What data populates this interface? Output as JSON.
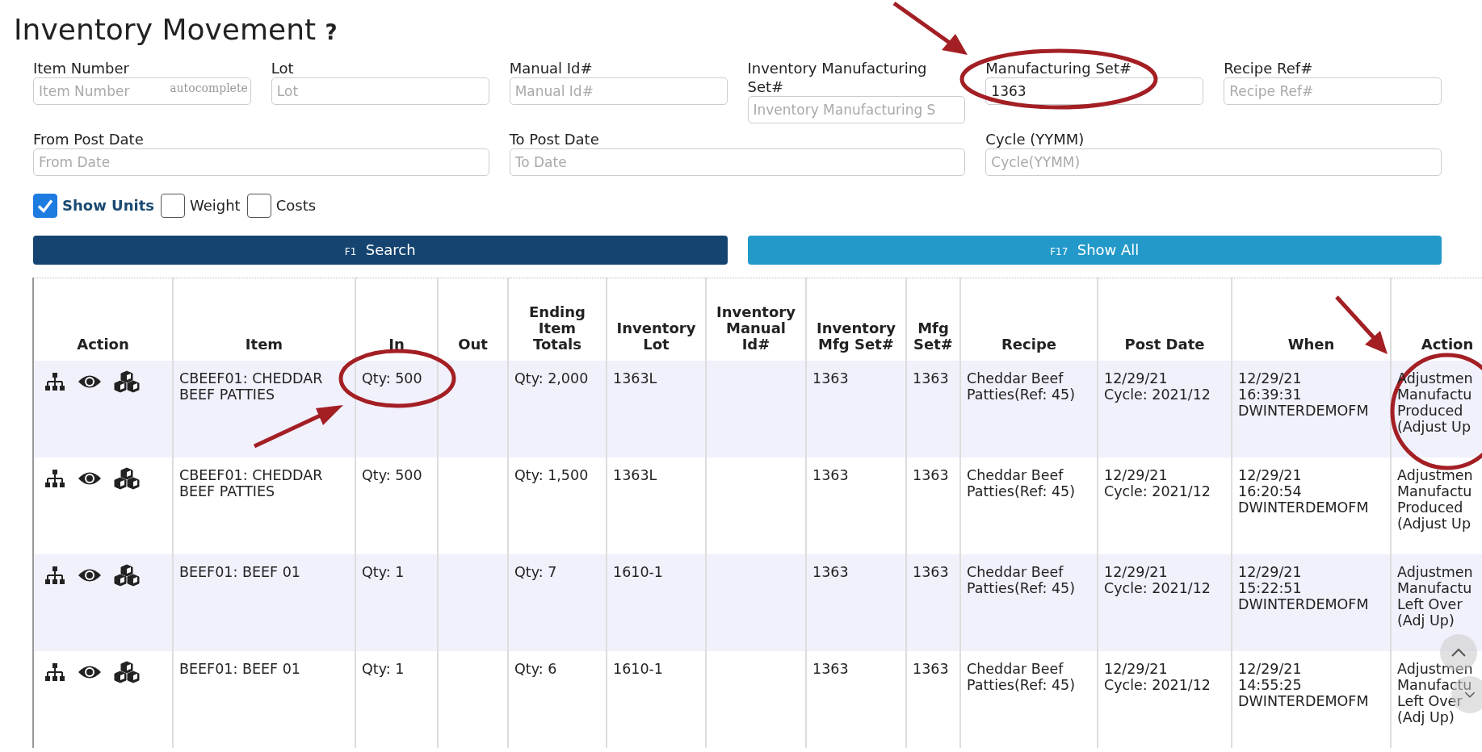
{
  "title": "Inventory Movement",
  "help": "?",
  "filter_rows": [
    [
      {
        "label": "Item Number",
        "placeholder": "Item Number",
        "hint": "autocomplete"
      },
      {
        "label": "Lot",
        "placeholder": "Lot"
      },
      {
        "label": "Manual Id#",
        "placeholder": "Manual Id#"
      },
      {
        "label": "Inventory Manufacturing Set#",
        "placeholder": "Inventory Manufacturing S"
      },
      {
        "label": "Manufacturing Set#",
        "value": "1363"
      },
      {
        "label": "Recipe Ref#",
        "placeholder": "Recipe Ref#"
      }
    ],
    [
      {
        "label": "From Post Date",
        "placeholder": "From Date"
      },
      {
        "label": "To Post Date",
        "placeholder": "To Date"
      },
      {
        "label": "Cycle (YYMM)",
        "placeholder": "Cycle(YYMM)"
      }
    ]
  ],
  "options": [
    {
      "label": "Show Units",
      "checked": true
    },
    {
      "label": "Weight",
      "checked": false
    },
    {
      "label": "Costs",
      "checked": false
    }
  ],
  "buttons": [
    {
      "key": "F1",
      "label": "Search",
      "kind": "primary"
    },
    {
      "key": "F17",
      "label": "Show All",
      "kind": "secondary"
    }
  ],
  "table": {
    "columns": [
      "Action",
      "Item",
      "In",
      "Out",
      "Ending Item Totals",
      "Inventory Lot",
      "Inventory Manual Id#",
      "Inventory Mfg Set#",
      "Mfg Set#",
      "Recipe",
      "Post Date",
      "When",
      "Action"
    ],
    "rows": [
      {
        "item": "CBEEF01: CHEDDAR BEEF PATTIES",
        "in": "Qty: 500",
        "ending": "Qty: 2,000",
        "lot": "1363L",
        "inv_mfg_set": "1363",
        "mfg_set": "1363",
        "recipe": "Cheddar Beef Patties(Ref: 45)",
        "post_date": [
          "12/29/21",
          "Cycle: 2021/12"
        ],
        "when": [
          "12/29/21",
          "16:39:31",
          "DWINTERDEMOFM"
        ],
        "action": [
          "Adjustmen",
          "Manufactu",
          "Produced",
          "(Adjust Up"
        ]
      },
      {
        "item": "CBEEF01: CHEDDAR BEEF PATTIES",
        "in": "Qty: 500",
        "ending": "Qty: 1,500",
        "lot": "1363L",
        "inv_mfg_set": "1363",
        "mfg_set": "1363",
        "recipe": "Cheddar Beef Patties(Ref: 45)",
        "post_date": [
          "12/29/21",
          "Cycle: 2021/12"
        ],
        "when": [
          "12/29/21",
          "16:20:54",
          "DWINTERDEMOFM"
        ],
        "action": [
          "Adjustmen",
          "Manufactu",
          "Produced",
          "(Adjust Up"
        ]
      },
      {
        "item": "BEEF01: BEEF 01",
        "in": "Qty: 1",
        "ending": "Qty: 7",
        "lot": "1610-1",
        "inv_mfg_set": "1363",
        "mfg_set": "1363",
        "recipe": "Cheddar Beef Patties(Ref: 45)",
        "post_date": [
          "12/29/21",
          "Cycle: 2021/12"
        ],
        "when": [
          "12/29/21",
          "15:22:51",
          "DWINTERDEMOFM"
        ],
        "action": [
          "Adjustmen",
          "Manufactu",
          "Left Over",
          "(Adj Up)"
        ]
      },
      {
        "item": "BEEF01: BEEF 01",
        "in": "Qty: 1",
        "ending": "Qty: 6",
        "lot": "1610-1",
        "inv_mfg_set": "1363",
        "mfg_set": "1363",
        "recipe": "Cheddar Beef Patties(Ref: 45)",
        "post_date": [
          "12/29/21",
          "Cycle: 2021/12"
        ],
        "when": [
          "12/29/21",
          "14:55:25",
          "DWINTERDEMOFM"
        ],
        "action": [
          "Adjustmen",
          "Manufactu",
          "Left Over",
          "(Adj Up)"
        ]
      }
    ]
  }
}
